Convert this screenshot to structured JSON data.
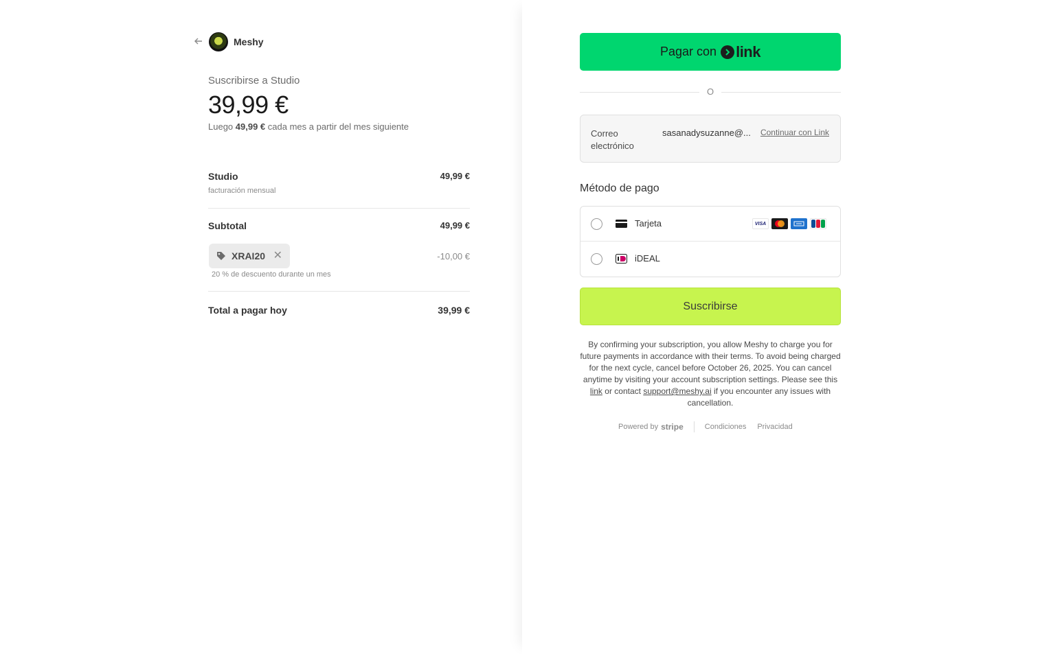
{
  "brand": {
    "name": "Meshy",
    "icon": "meshy-logo"
  },
  "summary": {
    "title": "Suscribirse a Studio",
    "price": "39,99 €",
    "note_prefix": "Luego",
    "note_amount": "49,99 €",
    "note_suffix": "cada mes a partir del mes siguiente"
  },
  "items": {
    "plan": {
      "name": "Studio",
      "sub": "facturación mensual",
      "amount": "49,99 €"
    },
    "subtotal": {
      "name": "Subtotal",
      "amount": "49,99 €"
    },
    "promo": {
      "code": "XRAI20",
      "amount": "-10,00 €",
      "note": "20 % de descuento durante un mes"
    },
    "total": {
      "name": "Total a pagar hoy",
      "amount": "39,99 €"
    }
  },
  "link_button": {
    "label": "Pagar con",
    "logo_word": "link"
  },
  "divider_text": "O",
  "email": {
    "label": "Correo electrónico",
    "value": "sasanadysuzanne@...",
    "link": "Continuar con Link"
  },
  "payment": {
    "title": "Método de pago",
    "methods": [
      {
        "label": "Tarjeta",
        "icon": "card-icon"
      },
      {
        "label": "iDEAL",
        "icon": "ideal-icon"
      }
    ],
    "cards": [
      "VISA",
      "Mastercard",
      "AMEX",
      "JCB"
    ]
  },
  "subscribe_button": "Suscribirse",
  "legal": {
    "part1": "By confirming your subscription, you allow Meshy to charge you for future payments in accordance with their terms. To avoid being charged for the next cycle, cancel before October 26, 2025. You can cancel anytime by visiting your account subscription settings. Please see this",
    "link1": "link",
    "part2": "or contact",
    "link2": "support@meshy.ai",
    "part3": "if you encounter any issues with cancellation."
  },
  "footer": {
    "powered": "Powered by",
    "stripe": "stripe",
    "terms": "Condiciones",
    "privacy": "Privacidad"
  },
  "colors": {
    "link_green": "#00d66f",
    "subscribe_lime": "#c7f44e"
  }
}
